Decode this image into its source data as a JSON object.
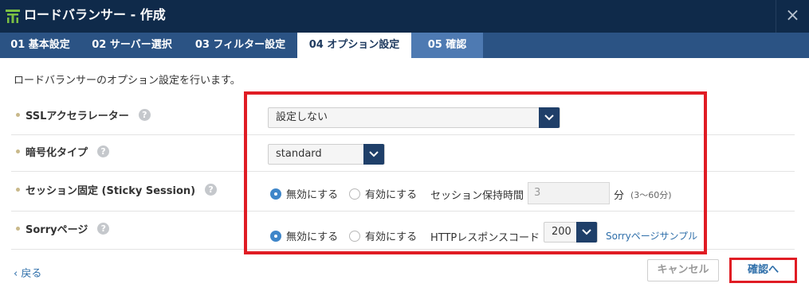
{
  "window": {
    "title": "ロードバランサー - 作成",
    "close_symbol": "×"
  },
  "tabs": [
    {
      "label": "01 基本設定"
    },
    {
      "label": "02 サーバー選択"
    },
    {
      "label": "03 フィルター設定"
    },
    {
      "label": "04 オプション設定",
      "active": true
    },
    {
      "label": "05 確認"
    }
  ],
  "description": "ロードバランサーのオプション設定を行います。",
  "rows": {
    "ssl": {
      "label": "SSLアクセラレーター",
      "help": "?",
      "selected": "設定しない"
    },
    "encryption": {
      "label": "暗号化タイプ",
      "help": "?",
      "selected": "standard"
    },
    "session": {
      "label": "セッション固定 (Sticky Session)",
      "help": "?",
      "option_off": "無効にする",
      "option_on": "有効にする",
      "selected": "無効にする",
      "hold_label": "セッション保持時間",
      "hold_value": "3",
      "unit": "分",
      "range": "(3〜60分)"
    },
    "sorry": {
      "label": "Sorryページ",
      "help": "?",
      "option_off": "無効にする",
      "option_on": "有効にする",
      "selected": "無効にする",
      "code_label": "HTTPレスポンスコード",
      "code_value": "200",
      "sample_link": "Sorryページサンプル"
    }
  },
  "footer": {
    "back": "戻る",
    "cancel": "キャンセル",
    "confirm": "確認へ"
  },
  "colors": {
    "titlebar": "#0f2a4a",
    "tabbar": "#2b5384",
    "highlight": "#e01c24",
    "accent": "#3f86c9"
  }
}
